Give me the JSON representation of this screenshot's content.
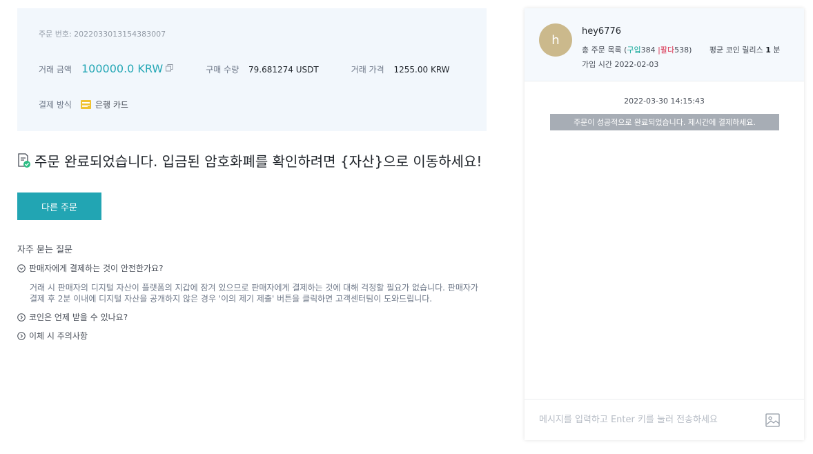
{
  "order": {
    "order_no": "주문 번호: 2022033013154383007",
    "amount_label": "거래 금액",
    "amount_value": "100000.0 KRW",
    "qty_label": "구매 수량",
    "qty_value": "79.681274 USDT",
    "price_label": "거래 가격",
    "price_value": "1255.00 KRW",
    "pay_label": "결제 방식",
    "pay_method": "은행 카드"
  },
  "completion_message": "주문 완료되었습니다. 입금된 암호화폐를 확인하려면 {자산}으로 이동하세요!",
  "other_order_button": "다른 주문",
  "faq": {
    "title": "자주 묻는 질문",
    "q1": "판매자에게 결제하는 것이 안전한가요?",
    "a1": "거래 시 판매자의 디지털 자산이 플랫폼의 지갑에 잠겨 있으므로 판매자에게 결제하는 것에 대해 걱정할 필요가 없습니다. 판매자가 결제 후 2분 이내에 디지털 자산을 공개하지 않은 경우 '이의 제기 제출' 버튼을 클릭하면 고객센터팀이 도와드립니다.",
    "q2": "코인은 언제 받을 수 있나요?",
    "q3": "이체 시 주의사항"
  },
  "chat": {
    "avatar_letter": "h",
    "username": "hey6776",
    "orders_prefix": "총 주문 목록 (",
    "buy_label": "구입",
    "buy_count": "384",
    "sep": " |",
    "sell_label": "팔다",
    "sell_count": "538",
    "orders_suffix": ")",
    "avg_label": "평균 코인 릴리스",
    "avg_value": "1",
    "avg_unit": "분",
    "joined": "가입 시간 2022-02-03",
    "timestamp": "2022-03-30 14:15:43",
    "system_message": "주문이 성공적으로 완료되었습니다. 제시간에 결제하세요.",
    "input_placeholder": "메시지를 입력하고 Enter 키를 눌러 전송하세요"
  },
  "colors": {
    "accent": "#22a5b3",
    "amount": "#24a7b5",
    "buy": "#0ea697",
    "sell": "#d9304e",
    "avatar": "#cbb98c"
  }
}
